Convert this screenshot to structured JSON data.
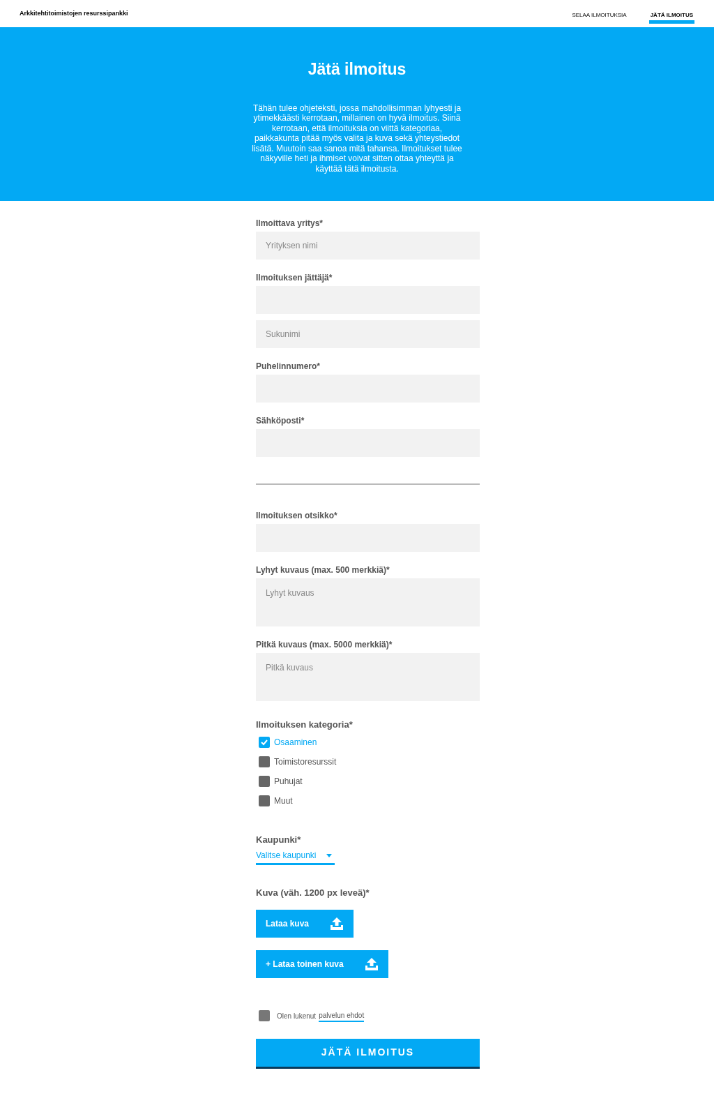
{
  "header": {
    "brand": "Arkkitehtitoimistojen resurssipankki",
    "nav": [
      {
        "label": "SELAA ILMOITUKSIA",
        "selected": false
      },
      {
        "label": "JÄTÄ ILMOITUS",
        "selected": true
      }
    ]
  },
  "hero": {
    "title": "Jätä ilmoitus",
    "text": "Tähän tulee ohjeteksti, jossa mahdollisimman lyhyesti ja ytimekkäästi kerrotaan, millainen on hyvä ilmoitus. Siinä kerrotaan, että ilmoituksia on viittä kategoriaa, paikkakunta pitää myös valita ja kuva sekä yhteystiedot lisätä. Muutoin saa sanoa mitä tahansa. Ilmoitukset tulee näkyville heti ja ihmiset voivat sitten ottaa yhteyttä ja käyttää tätä ilmoitusta."
  },
  "contact_fields": [
    {
      "label": "Ilmoittava yritys*",
      "inputs": [
        {
          "kind": "text",
          "placeholder": "Yrityksen nimi"
        }
      ]
    },
    {
      "label": "Ilmoituksen jättäjä*",
      "inputs": [
        {
          "kind": "text"
        },
        {
          "kind": "text",
          "placeholder": "Sukunimi"
        }
      ]
    },
    {
      "label": "Puhelinnumero*",
      "inputs": [
        {
          "kind": "text"
        }
      ]
    },
    {
      "label": "Sähköposti*",
      "inputs": [
        {
          "kind": "text"
        }
      ]
    }
  ],
  "ad_fields": [
    {
      "label": "Ilmoituksen otsikko*",
      "inputs": [
        {
          "kind": "text"
        }
      ]
    },
    {
      "label": "Lyhyt kuvaus (max. 500 merkkiä)*",
      "inputs": [
        {
          "kind": "textarea",
          "placeholder": "Lyhyt kuvaus"
        }
      ]
    },
    {
      "label": "Pitkä kuvaus (max. 5000 merkkiä)*",
      "inputs": [
        {
          "kind": "textarea",
          "placeholder": "Pitkä kuvaus"
        }
      ]
    }
  ],
  "category": {
    "label": "Ilmoituksen kategoria*",
    "options": [
      {
        "label": "Osaaminen",
        "checked": true
      },
      {
        "label": "Toimistoresurssit",
        "checked": false
      },
      {
        "label": "Puhujat",
        "checked": false
      },
      {
        "label": "Muut",
        "checked": false
      }
    ]
  },
  "city": {
    "label": "Kaupunki*",
    "value": "Valitse kaupunki"
  },
  "image": {
    "label": "Kuva (väh. 1200 px leveä)*",
    "buttons": [
      "Lataa kuva",
      "+ Lataa toinen kuva"
    ]
  },
  "terms": {
    "text": "Olen lukenut",
    "link": "palvelun ehdot",
    "checked": false
  },
  "submit": "JÄTÄ ILMOITUS"
}
